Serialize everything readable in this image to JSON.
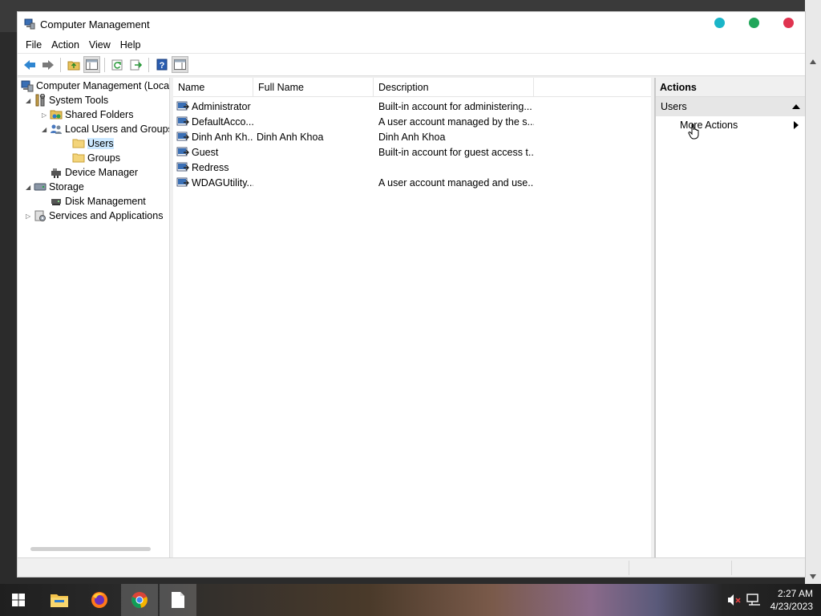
{
  "window": {
    "title": "Computer Management",
    "control_colors": [
      "#1ab5c8",
      "#21a65a",
      "#e0334f"
    ]
  },
  "menu": [
    "File",
    "Action",
    "View",
    "Help"
  ],
  "toolbar": {
    "icons": [
      "back-arrow-icon",
      "forward-arrow-icon",
      "up-folder-icon",
      "show-hide-tree-icon",
      "refresh-icon",
      "export-list-icon",
      "help-icon",
      "show-hide-action-pane-icon"
    ]
  },
  "tree": {
    "items": [
      {
        "label": "Computer Management (Local",
        "indent": 0,
        "expander": "",
        "icon": "computer-management-icon"
      },
      {
        "label": "System Tools",
        "indent": 1,
        "expander": "◢",
        "icon": "system-tools-icon"
      },
      {
        "label": "Shared Folders",
        "indent": 2,
        "expander": "▷",
        "icon": "shared-folder-icon"
      },
      {
        "label": "Local Users and Groups",
        "indent": 2,
        "expander": "◢",
        "icon": "users-groups-icon"
      },
      {
        "label": "Users",
        "indent": 3,
        "expander": "",
        "icon": "folder-icon",
        "selected": true
      },
      {
        "label": "Groups",
        "indent": 3,
        "expander": "",
        "icon": "folder-icon"
      },
      {
        "label": "Device Manager",
        "indent": 2,
        "expander": "",
        "icon": "device-manager-icon"
      },
      {
        "label": "Storage",
        "indent": 1,
        "expander": "◢",
        "icon": "storage-icon"
      },
      {
        "label": "Disk Management",
        "indent": 2,
        "expander": "",
        "icon": "disk-management-icon"
      },
      {
        "label": "Services and Applications",
        "indent": 1,
        "expander": "▷",
        "icon": "services-icon"
      }
    ]
  },
  "list": {
    "columns": [
      "Name",
      "Full Name",
      "Description"
    ],
    "rows": [
      {
        "name": "Administrator",
        "full_name": "",
        "description": "Built-in account for administering..."
      },
      {
        "name": "DefaultAcco...",
        "full_name": "",
        "description": "A user account managed by the s..."
      },
      {
        "name": "Dinh Anh Kh...",
        "full_name": "Dinh Anh Khoa",
        "description": "Dinh Anh Khoa"
      },
      {
        "name": "Guest",
        "full_name": "",
        "description": "Built-in account for guest access t..."
      },
      {
        "name": "Redress",
        "full_name": "",
        "description": ""
      },
      {
        "name": "WDAGUtility...",
        "full_name": "",
        "description": "A user account managed and use..."
      }
    ]
  },
  "actions": {
    "header": "Actions",
    "section": "Users",
    "items": [
      "More Actions"
    ]
  },
  "taskbar": {
    "apps": [
      "windows-start-icon",
      "file-explorer-icon",
      "firefox-icon",
      "chrome-icon",
      "notepad-icon"
    ],
    "time": "2:27 AM",
    "date": "4/23/2023"
  }
}
